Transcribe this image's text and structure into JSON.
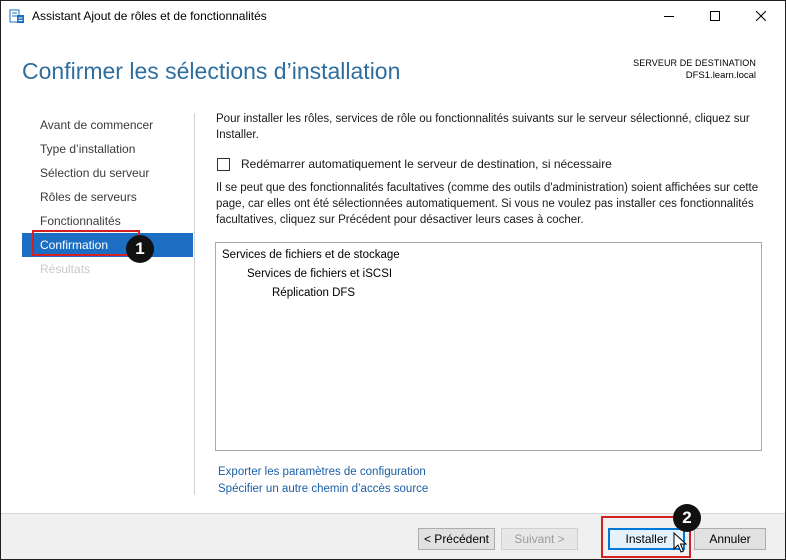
{
  "window": {
    "title": "Assistant Ajout de rôles et de fonctionnalités",
    "icon": "server-manager-icon"
  },
  "header": {
    "title": "Confirmer les sélections d’installation",
    "destination_label": "SERVEUR DE DESTINATION",
    "destination_server": "DFS1.learn.local"
  },
  "nav": {
    "items": [
      {
        "label": "Avant de commencer",
        "state": "normal"
      },
      {
        "label": "Type d’installation",
        "state": "normal"
      },
      {
        "label": "Sélection du serveur",
        "state": "normal"
      },
      {
        "label": "Rôles de serveurs",
        "state": "normal"
      },
      {
        "label": "Fonctionnalités",
        "state": "normal"
      },
      {
        "label": "Confirmation",
        "state": "active"
      },
      {
        "label": "Résultats",
        "state": "disabled"
      }
    ]
  },
  "content": {
    "intro": "Pour installer les rôles, services de rôle ou fonctionnalités suivants sur le serveur sélectionné, cliquez sur Installer.",
    "restart_checkbox_label": "Redémarrer automatiquement le serveur de destination, si nécessaire",
    "restart_checked": false,
    "note": "Il se peut que des fonctionnalités facultatives (comme des outils d'administration) soient affichées sur cette page, car elles ont été sélectionnées automatiquement. Si vous ne voulez pas installer ces fonctionnalités facultatives, cliquez sur Précédent pour désactiver leurs cases à cocher.",
    "selections": [
      {
        "label": "Services de fichiers et de stockage",
        "level": 0
      },
      {
        "label": "Services de fichiers et iSCSI",
        "level": 1
      },
      {
        "label": "Réplication DFS",
        "level": 2
      }
    ],
    "export_link": "Exporter les paramètres de configuration",
    "alt_source_link": "Spécifier un autre chemin d’accès source"
  },
  "footer": {
    "previous": "< Précédent",
    "next": "Suivant >",
    "install": "Installer",
    "cancel": "Annuler"
  },
  "annotations": {
    "step1": "1",
    "step2": "2",
    "highlight_color": "#d42020"
  },
  "colors": {
    "accent": "#1b6ec2",
    "title": "#2f6f9f",
    "link": "#1a5fa8"
  }
}
